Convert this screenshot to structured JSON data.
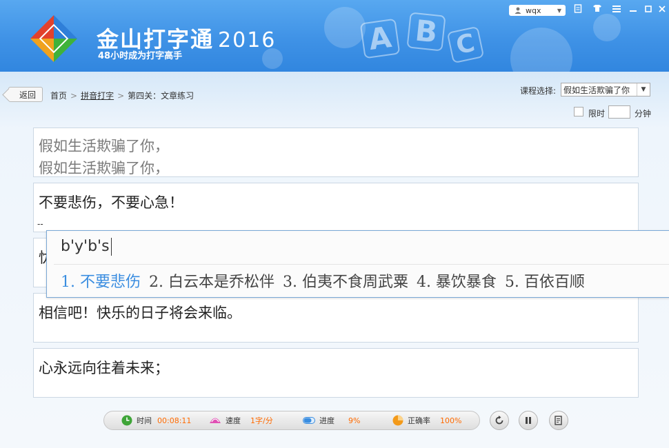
{
  "header": {
    "brand": "金山打字通",
    "year": "2016",
    "slogan": "48小时成为打字高手",
    "decor_letters": [
      "A",
      "B",
      "C"
    ],
    "user": "wqx",
    "window_buttons": [
      "skin-icon",
      "shirt-icon",
      "menu-icon",
      "minimize-icon",
      "restore-icon",
      "close-icon"
    ]
  },
  "nav": {
    "back": "返回",
    "breadcrumb": [
      "首页",
      "拼音打字",
      "第四关：文章练习"
    ],
    "separator": ">"
  },
  "course": {
    "label": "课程选择:",
    "selected": "假如生活欺骗了你"
  },
  "time_limit": {
    "label": "限时",
    "value": "",
    "unit": "分钟",
    "checked": false
  },
  "lines": [
    {
      "source": "假如生活欺骗了你，",
      "typed": "假如生活欺骗了你，"
    },
    {
      "source": "不要悲伤，不要心急！",
      "typed": "--"
    },
    {
      "source": "忧",
      "typed": ""
    },
    {
      "source": "相信吧！快乐的日子将会来临。",
      "typed": ""
    },
    {
      "source": "心永远向往着未来；",
      "typed": ""
    }
  ],
  "ime": {
    "composition": "b'y'b's",
    "candidates": [
      "1. 不要悲伤",
      "2. 白云本是乔松伴",
      "3. 伯夷不食周武粟",
      "4. 暴饮暴食",
      "5. 百依百顺"
    ],
    "selected_index": 0
  },
  "stats": {
    "time_label": "时间",
    "time_value": "00:08:11",
    "speed_label": "速度",
    "speed_value": "1字/分",
    "progress_label": "进度",
    "progress_value": "9%",
    "accuracy_label": "正确率",
    "accuracy_value": "100%"
  },
  "controls": [
    "restart-icon",
    "pause-icon",
    "report-icon"
  ],
  "colors": {
    "accent": "#3a8de0",
    "stat_value": "#ff6a00",
    "header": "#3f92e6"
  }
}
